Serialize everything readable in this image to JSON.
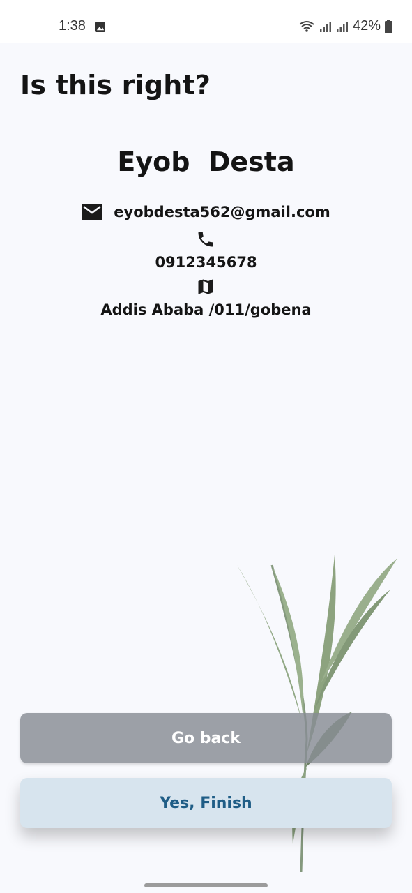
{
  "status_bar": {
    "time": "1:38",
    "battery": "42%"
  },
  "page": {
    "title": "Is this right?"
  },
  "profile": {
    "name": "Eyob  Desta",
    "email": "eyobdesta562@gmail.com",
    "phone": "0912345678",
    "address": "Addis Ababa /011/gobena"
  },
  "icons": {
    "email": "mail-icon",
    "phone": "phone-icon",
    "address": "map-icon"
  },
  "actions": {
    "back_label": "Go back",
    "finish_label": "Yes, Finish"
  },
  "colors": {
    "finish_text": "#1f5d86",
    "finish_bg": "#d7e4ee",
    "back_bg": "#878c94"
  }
}
